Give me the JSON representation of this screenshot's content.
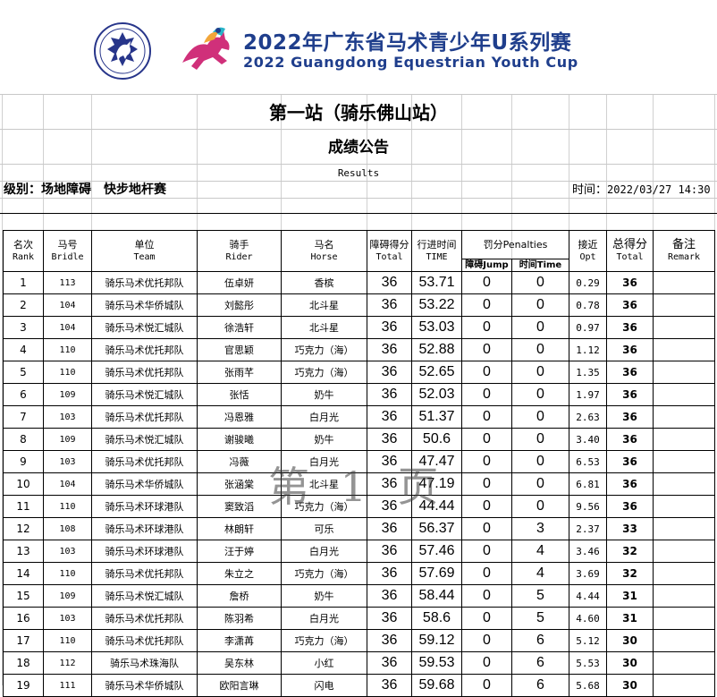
{
  "header": {
    "title_cn": "2022年广东省马术青少年U系列赛",
    "title_en": "2022 Guangdong Equestrian Youth Cup",
    "stage": "第一站（骑乐佛山站）",
    "notice": "成绩公告",
    "results_label": "Results",
    "category": "级别：场地障碍　快步地杆赛",
    "time_label": "时间：",
    "time_value": "2022/03/27 14:30"
  },
  "columns": {
    "rank": {
      "cn": "名次",
      "en": "Rank"
    },
    "bridle": {
      "cn": "马号",
      "en": "Bridle"
    },
    "team": {
      "cn": "单位",
      "en": "Team"
    },
    "rider": {
      "cn": "骑手",
      "en": "Rider"
    },
    "horse": {
      "cn": "马名",
      "en": "Horse"
    },
    "obstacle": {
      "cn": "障碍得分",
      "en": "Total"
    },
    "time": {
      "cn": "行进时间",
      "en": "TIME"
    },
    "penalties": {
      "label": "罚分Penalties",
      "jump": "障碍Jump",
      "time": "时间Time"
    },
    "opt": {
      "cn": "接近",
      "en": "Opt"
    },
    "total": {
      "cn": "总得分",
      "en": "Total"
    },
    "remark": {
      "cn": "备注",
      "en": "Remark"
    }
  },
  "rows": [
    {
      "rank": "1",
      "bridle": "113",
      "team": "骑乐马术优托邦队",
      "rider": "伍卓妍",
      "horse": "香槟",
      "obstacle": "36",
      "time": "53.71",
      "jump": "0",
      "tpen": "0",
      "opt": "0.29",
      "total": "36",
      "remark": ""
    },
    {
      "rank": "2",
      "bridle": "104",
      "team": "骑乐马术华侨城队",
      "rider": "刘懿彤",
      "horse": "北斗星",
      "obstacle": "36",
      "time": "53.22",
      "jump": "0",
      "tpen": "0",
      "opt": "0.78",
      "total": "36",
      "remark": ""
    },
    {
      "rank": "3",
      "bridle": "104",
      "team": "骑乐马术悦汇城队",
      "rider": "徐浩轩",
      "horse": "北斗星",
      "obstacle": "36",
      "time": "53.03",
      "jump": "0",
      "tpen": "0",
      "opt": "0.97",
      "total": "36",
      "remark": ""
    },
    {
      "rank": "4",
      "bridle": "110",
      "team": "骑乐马术优托邦队",
      "rider": "官思颖",
      "horse": "巧克力（海）",
      "obstacle": "36",
      "time": "52.88",
      "jump": "0",
      "tpen": "0",
      "opt": "1.12",
      "total": "36",
      "remark": ""
    },
    {
      "rank": "5",
      "bridle": "110",
      "team": "骑乐马术优托邦队",
      "rider": "张雨芊",
      "horse": "巧克力（海）",
      "obstacle": "36",
      "time": "52.65",
      "jump": "0",
      "tpen": "0",
      "opt": "1.35",
      "total": "36",
      "remark": ""
    },
    {
      "rank": "6",
      "bridle": "109",
      "team": "骑乐马术悦汇城队",
      "rider": "张恬",
      "horse": "奶牛",
      "obstacle": "36",
      "time": "52.03",
      "jump": "0",
      "tpen": "0",
      "opt": "1.97",
      "total": "36",
      "remark": ""
    },
    {
      "rank": "7",
      "bridle": "103",
      "team": "骑乐马术优托邦队",
      "rider": "冯恩雅",
      "horse": "白月光",
      "obstacle": "36",
      "time": "51.37",
      "jump": "0",
      "tpen": "0",
      "opt": "2.63",
      "total": "36",
      "remark": ""
    },
    {
      "rank": "8",
      "bridle": "109",
      "team": "骑乐马术悦汇城队",
      "rider": "谢骏曦",
      "horse": "奶牛",
      "obstacle": "36",
      "time": "50.6",
      "jump": "0",
      "tpen": "0",
      "opt": "3.40",
      "total": "36",
      "remark": ""
    },
    {
      "rank": "9",
      "bridle": "103",
      "team": "骑乐马术优托邦队",
      "rider": "冯薇",
      "horse": "白月光",
      "obstacle": "36",
      "time": "47.47",
      "jump": "0",
      "tpen": "0",
      "opt": "6.53",
      "total": "36",
      "remark": ""
    },
    {
      "rank": "10",
      "bridle": "104",
      "team": "骑乐马术华侨城队",
      "rider": "张涵棠",
      "horse": "北斗星",
      "obstacle": "36",
      "time": "47.19",
      "jump": "0",
      "tpen": "0",
      "opt": "6.81",
      "total": "36",
      "remark": ""
    },
    {
      "rank": "11",
      "bridle": "110",
      "team": "骑乐马术环球港队",
      "rider": "窦致滔",
      "horse": "巧克力（海）",
      "obstacle": "36",
      "time": "44.44",
      "jump": "0",
      "tpen": "0",
      "opt": "9.56",
      "total": "36",
      "remark": ""
    },
    {
      "rank": "12",
      "bridle": "108",
      "team": "骑乐马术环球港队",
      "rider": "林朗轩",
      "horse": "可乐",
      "obstacle": "36",
      "time": "56.37",
      "jump": "0",
      "tpen": "3",
      "opt": "2.37",
      "total": "33",
      "remark": ""
    },
    {
      "rank": "13",
      "bridle": "103",
      "team": "骑乐马术环球港队",
      "rider": "汪于婷",
      "horse": "白月光",
      "obstacle": "36",
      "time": "57.46",
      "jump": "0",
      "tpen": "4",
      "opt": "3.46",
      "total": "32",
      "remark": ""
    },
    {
      "rank": "14",
      "bridle": "110",
      "team": "骑乐马术优托邦队",
      "rider": "朱立之",
      "horse": "巧克力（海）",
      "obstacle": "36",
      "time": "57.69",
      "jump": "0",
      "tpen": "4",
      "opt": "3.69",
      "total": "32",
      "remark": ""
    },
    {
      "rank": "15",
      "bridle": "109",
      "team": "骑乐马术悦汇城队",
      "rider": "詹桥",
      "horse": "奶牛",
      "obstacle": "36",
      "time": "58.44",
      "jump": "0",
      "tpen": "5",
      "opt": "4.44",
      "total": "31",
      "remark": ""
    },
    {
      "rank": "16",
      "bridle": "103",
      "team": "骑乐马术优托邦队",
      "rider": "陈羽希",
      "horse": "白月光",
      "obstacle": "36",
      "time": "58.6",
      "jump": "0",
      "tpen": "5",
      "opt": "4.60",
      "total": "31",
      "remark": ""
    },
    {
      "rank": "17",
      "bridle": "110",
      "team": "骑乐马术优托邦队",
      "rider": "李潇苒",
      "horse": "巧克力（海）",
      "obstacle": "36",
      "time": "59.12",
      "jump": "0",
      "tpen": "6",
      "opt": "5.12",
      "total": "30",
      "remark": ""
    },
    {
      "rank": "18",
      "bridle": "112",
      "team": "骑乐马术珠海队",
      "rider": "吴东林",
      "horse": "小红",
      "obstacle": "36",
      "time": "59.53",
      "jump": "0",
      "tpen": "6",
      "opt": "5.53",
      "total": "30",
      "remark": ""
    },
    {
      "rank": "19",
      "bridle": "111",
      "team": "骑乐马术华侨城队",
      "rider": "欧阳言琳",
      "horse": "闪电",
      "obstacle": "36",
      "time": "59.68",
      "jump": "0",
      "tpen": "6",
      "opt": "5.68",
      "total": "30",
      "remark": ""
    }
  ],
  "watermark": "第 1 页",
  "colors": {
    "title_blue": "#1f3e8c",
    "logo_blue": "#27358a",
    "accent_pink": "#d0307a",
    "accent_cyan": "#28b4c8"
  }
}
